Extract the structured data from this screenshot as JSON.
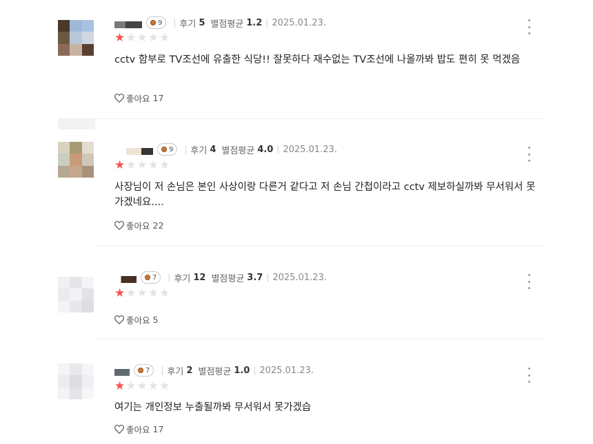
{
  "reviews": [
    {
      "badge": "9",
      "review_label": "후기",
      "review_count": "5",
      "rating_label": "별점평균",
      "rating_avg": "1.2",
      "date": "2025.01.23.",
      "text": "cctv 함부로 TV조선에 유출한 식당!!  잘못하다 재수없는 TV조선에 나올까봐 밥도 편히 못 먹겠음",
      "like_label": "좋아요",
      "like_count": "17",
      "stars": 1
    },
    {
      "badge": "9",
      "review_label": "후기",
      "review_count": "4",
      "rating_label": "별점평균",
      "rating_avg": "4.0",
      "date": "2025.01.23.",
      "text": "사장님이 저 손님은 본인 사상이랑 다른거 같다고 저 손님 간첩이라고 cctv 제보하실까봐 무서워서 못가겠네요....",
      "like_label": "좋아요",
      "like_count": "22",
      "stars": 1
    },
    {
      "badge": "7",
      "review_label": "후기",
      "review_count": "12",
      "rating_label": "별점평균",
      "rating_avg": "3.7",
      "date": "2025.01.23.",
      "text": "",
      "like_label": "좋아요",
      "like_count": "5",
      "stars": 1
    },
    {
      "badge": "7",
      "review_label": "후기",
      "review_count": "2",
      "rating_label": "별점평균",
      "rating_avg": "1.0",
      "date": "2025.01.23.",
      "text": "여기는 개인정보 누출될까봐 무서워서 못가겠습",
      "like_label": "좋아요",
      "like_count": "17",
      "stars": 1
    }
  ],
  "icons": {
    "star_filled": "star-filled-icon",
    "star_empty": "star-empty-icon",
    "heart": "heart-icon",
    "more": "more-vertical-icon",
    "badge": "badge-medal-icon"
  },
  "colors": {
    "star_active": "#f5524f",
    "star_inactive": "#e3e3e3",
    "badge_dot": "#c77a37"
  }
}
